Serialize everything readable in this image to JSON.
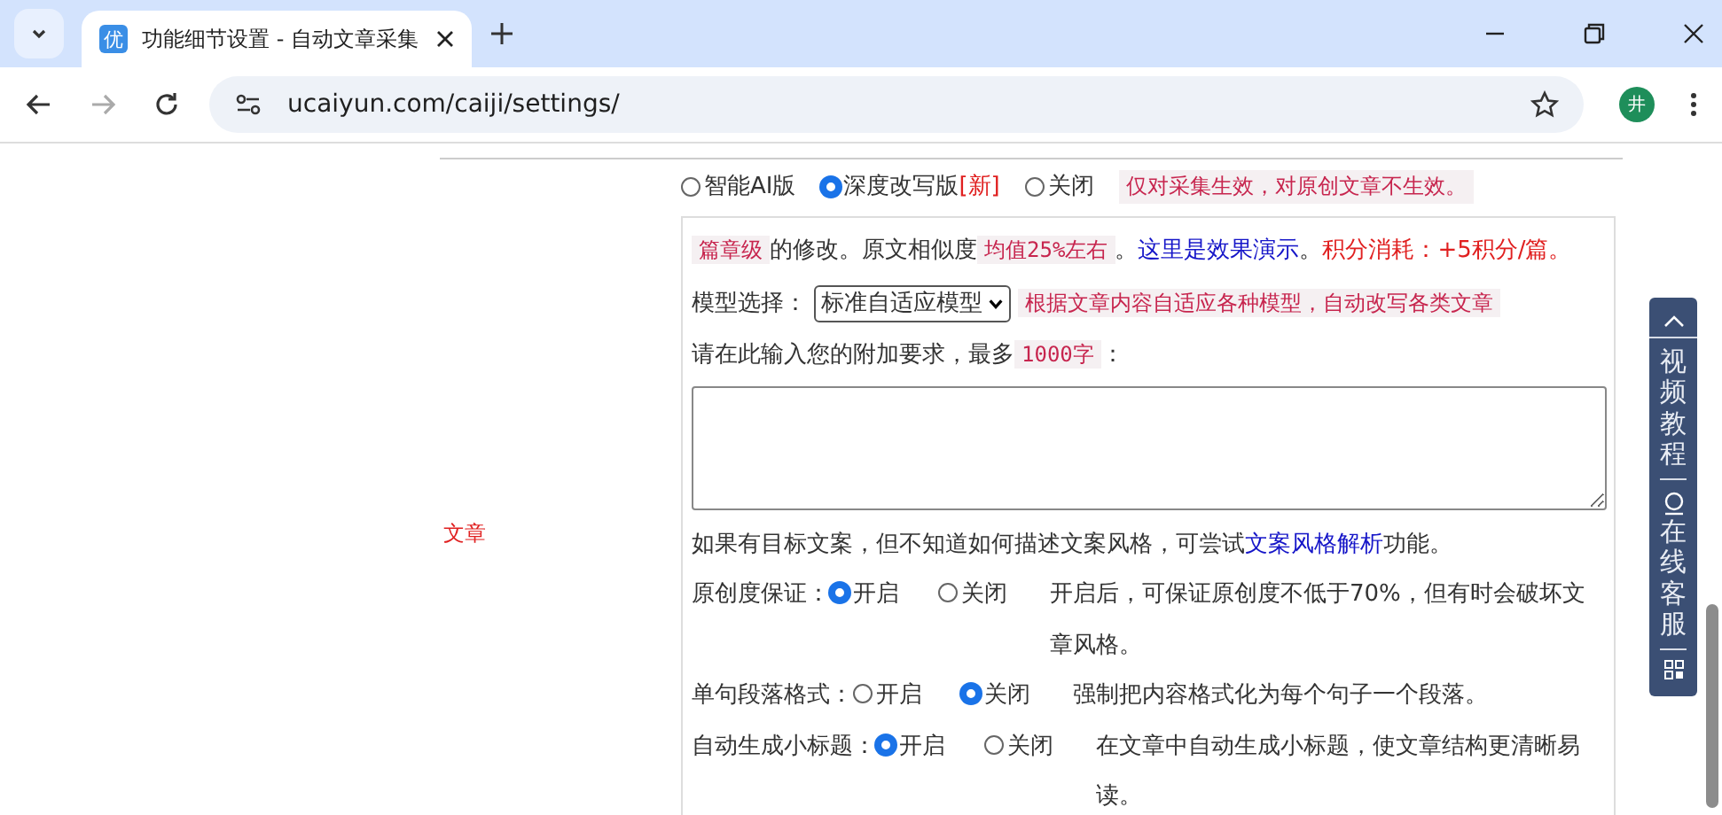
{
  "browser": {
    "tab": {
      "favicon_text": "优",
      "title": "功能细节设置 - 自动文章采集",
      "selected": true
    },
    "url": "ucaiyun.com/caiji/settings/",
    "profile_initial": "井"
  },
  "rewrite_mode": {
    "options": [
      {
        "label": "智能AI版",
        "selected": false
      },
      {
        "label": "深度改写版",
        "badge": "[新]",
        "selected": true
      },
      {
        "label": "关闭",
        "selected": false
      }
    ],
    "note": "仅对采集生效，对原创文章不生效。"
  },
  "side_label": "文章",
  "panel": {
    "info": [
      {
        "kind": "tag",
        "text": "篇章级"
      },
      {
        "kind": "plain",
        "text": "的修改。原文相似度"
      },
      {
        "kind": "tag",
        "text": "均值25%左右"
      },
      {
        "kind": "plain",
        "text": "。"
      },
      {
        "kind": "link",
        "text": "这里是效果演示"
      },
      {
        "kind": "plain",
        "text": "。"
      },
      {
        "kind": "alert",
        "text": "积分消耗：+5积分/篇。"
      }
    ],
    "model": {
      "label": "模型选择：",
      "value": "标准自适应模型",
      "note": "根据文章内容自适应各种模型，自动改写各类文章"
    },
    "extra": {
      "label": "请在此输入您的附加要求，最多",
      "limit": "1000字",
      "colon": "："
    },
    "style_hint": {
      "text": "如果有目标文案，但不知道如何描述文案风格，可尝试",
      "link": "文案风格解析",
      "tail": "功能。"
    },
    "settings": [
      {
        "label": "原创度保证：",
        "options": [
          {
            "label": "开启",
            "selected": true
          },
          {
            "label": "关闭",
            "selected": false
          }
        ],
        "description": "开启后，可保证原创度不低于70%，但有时会破坏文章风格。"
      },
      {
        "label": "单句段落格式：",
        "options": [
          {
            "label": "开启",
            "selected": false
          },
          {
            "label": "关闭",
            "selected": true
          }
        ],
        "description": "强制把内容格式化为每个句子一个段落。"
      },
      {
        "label": "自动生成小标题：",
        "options": [
          {
            "label": "开启",
            "selected": true
          },
          {
            "label": "关闭",
            "selected": false
          }
        ],
        "description": "在文章中自动生成小标题，使文章结构更清晰易读。"
      }
    ]
  },
  "float_bar": {
    "items": [
      {
        "kind": "top"
      },
      {
        "kind": "video",
        "label": "视频教程"
      },
      {
        "kind": "service",
        "label": "在线客服"
      },
      {
        "kind": "qr"
      }
    ]
  }
}
